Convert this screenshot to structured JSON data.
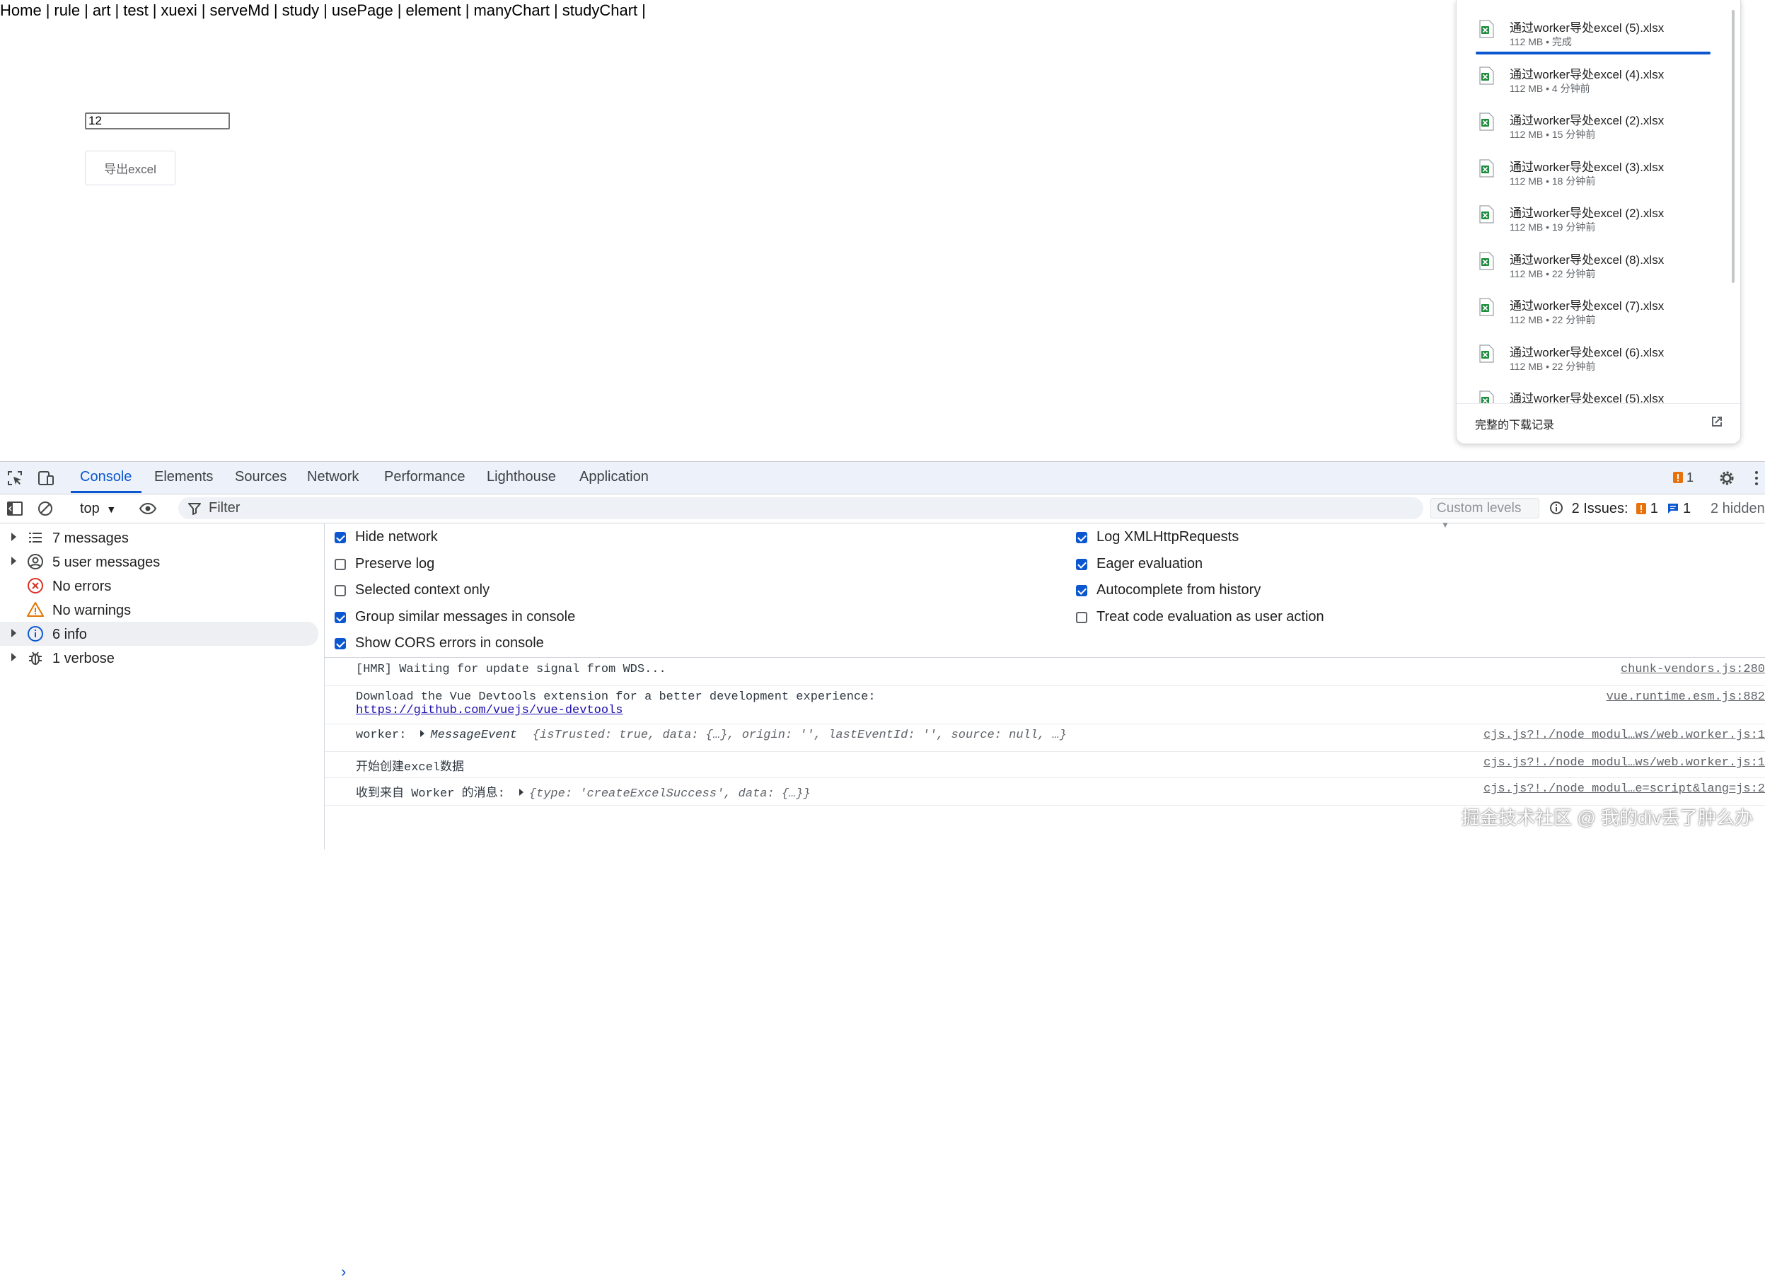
{
  "nav": {
    "links": [
      "Home",
      "rule",
      "art",
      "test",
      "xuexi",
      "serveMd",
      "study",
      "usePage",
      "element",
      "manyChart",
      "studyChart"
    ],
    "separator": "|"
  },
  "form": {
    "input_value": "12",
    "export_button": "导出excel"
  },
  "downloads": {
    "items": [
      {
        "name": "通过worker导处excel (5).xlsx",
        "meta": "112 MB • 完成"
      },
      {
        "name": "通过worker导处excel (4).xlsx",
        "meta": "112 MB • 4 分钟前"
      },
      {
        "name": "通过worker导处excel (2).xlsx",
        "meta": "112 MB • 15 分钟前"
      },
      {
        "name": "通过worker导处excel (3).xlsx",
        "meta": "112 MB • 18 分钟前"
      },
      {
        "name": "通过worker导处excel (2).xlsx",
        "meta": "112 MB • 19 分钟前"
      },
      {
        "name": "通过worker导处excel (8).xlsx",
        "meta": "112 MB • 22 分钟前"
      },
      {
        "name": "通过worker导处excel (7).xlsx",
        "meta": "112 MB • 22 分钟前"
      },
      {
        "name": "通过worker导处excel (6).xlsx",
        "meta": "112 MB • 22 分钟前"
      },
      {
        "name": "通过worker导处excel (5).xlsx",
        "meta": ""
      }
    ],
    "footer_label": "完整的下载记录",
    "file_icon_color": "#1e8e3e",
    "progress_color": "#0b57d0"
  },
  "devtools": {
    "tabs": [
      "Console",
      "Elements",
      "Sources",
      "Network",
      "Performance",
      "Lighthouse",
      "Application"
    ],
    "active_tab": "Console",
    "issue_badge": "1",
    "toolbar": {
      "context": "top",
      "filter_placeholder": "Filter",
      "levels": "Custom levels",
      "issues_label": "2 Issues:",
      "issues_warn": "1",
      "issues_info": "1",
      "hidden": "2 hidden"
    },
    "sidebar": [
      {
        "label": "7 messages",
        "icon": "list-icon",
        "expandable": true
      },
      {
        "label": "5 user messages",
        "icon": "user-icon",
        "expandable": true
      },
      {
        "label": "No errors",
        "icon": "error-icon",
        "expandable": false
      },
      {
        "label": "No warnings",
        "icon": "warning-icon",
        "expandable": false
      },
      {
        "label": "6 info",
        "icon": "info-icon",
        "expandable": true,
        "selected": true
      },
      {
        "label": "1 verbose",
        "icon": "bug-icon",
        "expandable": true
      }
    ],
    "settings_left": [
      {
        "label": "Hide network",
        "checked": true
      },
      {
        "label": "Preserve log",
        "checked": false
      },
      {
        "label": "Selected context only",
        "checked": false
      },
      {
        "label": "Group similar messages in console",
        "checked": true
      },
      {
        "label": "Show CORS errors in console",
        "checked": true
      }
    ],
    "settings_right": [
      {
        "label": "Log XMLHttpRequests",
        "checked": true
      },
      {
        "label": "Eager evaluation",
        "checked": true
      },
      {
        "label": "Autocomplete from history",
        "checked": true
      },
      {
        "label": "Treat code evaluation as user action",
        "checked": false
      }
    ],
    "messages": [
      {
        "text": "[HMR] Waiting for update signal from WDS...",
        "source": "chunk-vendors.js:280"
      },
      {
        "text": "Download the Vue Devtools extension for a better development experience:",
        "link": "https://github.com/vuejs/vue-devtools",
        "source": "vue.runtime.esm.js:882"
      },
      {
        "prefix": "worker:",
        "object_type": "MessageEvent",
        "object_body": "{isTrusted: true, data: {…}, origin: '', lastEventId: '', source: null,  …}",
        "source": "cjs.js?!./node_modul…ws/web.worker.js:1"
      },
      {
        "text": "开始创建excel数据",
        "source": "cjs.js?!./node_modul…ws/web.worker.js:1"
      },
      {
        "prefix": "收到来自 Worker 的消息:",
        "object_body": "{type: 'createExcelSuccess', data: {…}}",
        "source": "cjs.js?!./node_modul…e=script&lang=js:2"
      }
    ],
    "prompt_symbol": "›"
  },
  "watermark": "掘金技术社区 @ 我的div丢了肿么办"
}
